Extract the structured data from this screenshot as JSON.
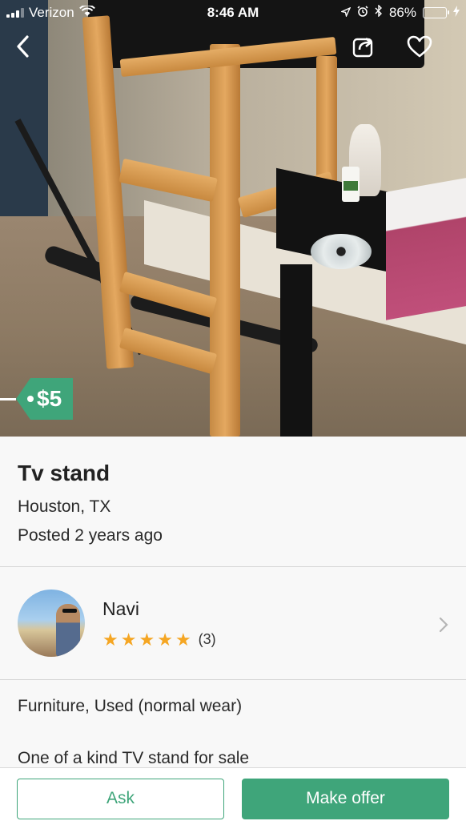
{
  "status_bar": {
    "carrier": "Verizon",
    "time": "8:46 AM",
    "battery_percent": "86%",
    "battery_level": 0.86,
    "icons": [
      "signal-icon",
      "wifi-icon",
      "location-icon",
      "alarm-icon",
      "bluetooth-icon",
      "battery-icon",
      "charging-icon"
    ]
  },
  "nav": {
    "back_icon": "back-chevron-icon",
    "share_icon": "share-icon",
    "favorite_icon": "heart-icon"
  },
  "listing": {
    "price": "$5",
    "title": "Tv stand",
    "location": "Houston, TX",
    "posted": "Posted 2 years ago",
    "category": "Furniture, Used (normal wear)",
    "description": "One of a kind TV stand for sale"
  },
  "seller": {
    "name": "Navi",
    "rating_stars": 5,
    "rating_count": "(3)"
  },
  "actions": {
    "ask_label": "Ask",
    "offer_label": "Make offer"
  },
  "colors": {
    "accent": "#3fa57a",
    "star": "#f5a623",
    "battery": "#4cd964"
  }
}
